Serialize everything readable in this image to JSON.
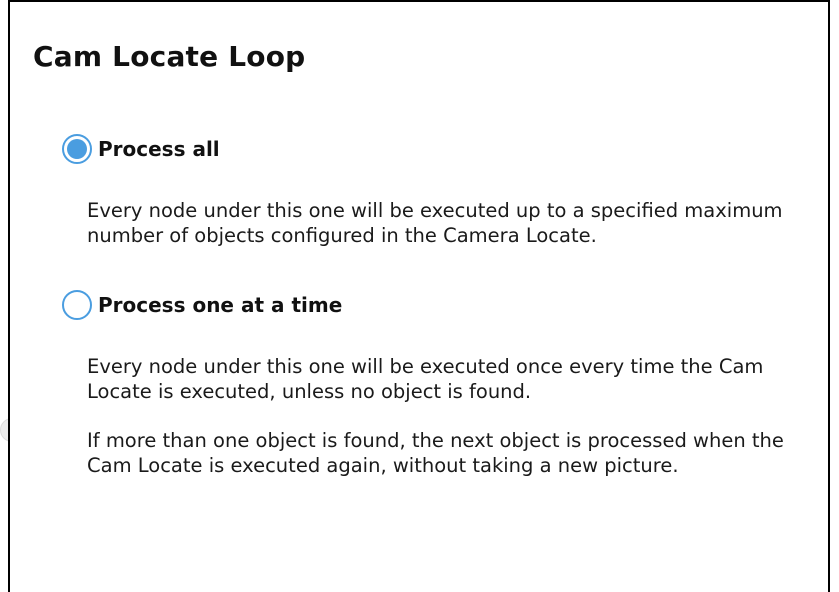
{
  "title": "Cam Locate Loop",
  "options": [
    {
      "label": "Process all",
      "selected": true,
      "descriptions": [
        "Every node under this one will be executed up to a specified maximum number of objects configured in the Camera Locate."
      ]
    },
    {
      "label": "Process one at a time",
      "selected": false,
      "descriptions": [
        "Every node under this one will be executed once every time the Cam Locate is executed, unless no object is found.",
        "If more than one object is found, the next object is processed when the Cam Locate is executed again, without taking a new picture."
      ]
    }
  ],
  "side_handle_icon": "chevron-right-icon",
  "colors": {
    "accent": "#4a9de0",
    "text": "#1a1a1a",
    "border": "#000000"
  }
}
